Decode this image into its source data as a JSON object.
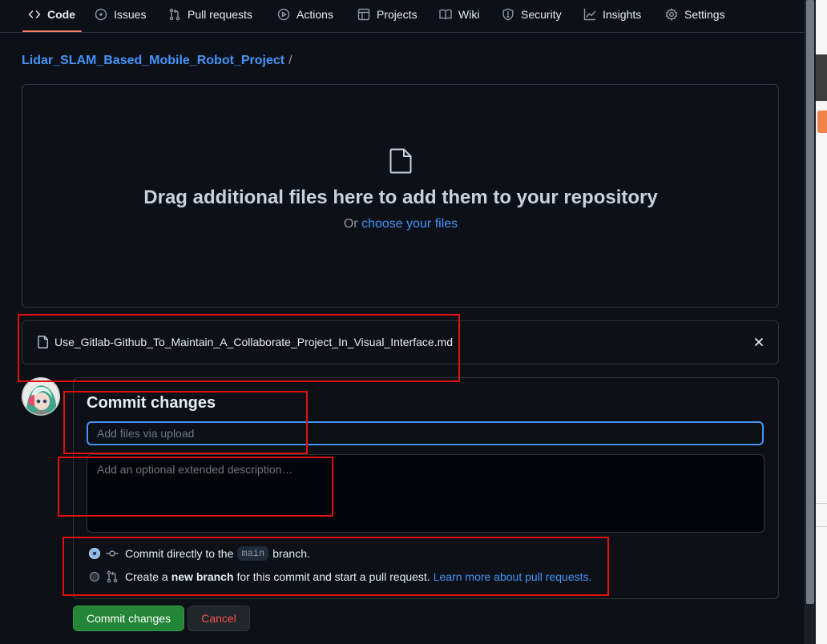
{
  "nav": {
    "tabs": [
      {
        "label": "Code",
        "icon": "code-icon",
        "active": true
      },
      {
        "label": "Issues",
        "icon": "issue-opened-icon",
        "active": false
      },
      {
        "label": "Pull requests",
        "icon": "git-pull-request-icon",
        "active": false
      },
      {
        "label": "Actions",
        "icon": "play-icon",
        "active": false
      },
      {
        "label": "Projects",
        "icon": "table-icon",
        "active": false
      },
      {
        "label": "Wiki",
        "icon": "book-icon",
        "active": false
      },
      {
        "label": "Security",
        "icon": "shield-icon",
        "active": false
      },
      {
        "label": "Insights",
        "icon": "graph-icon",
        "active": false
      },
      {
        "label": "Settings",
        "icon": "gear-icon",
        "active": false
      }
    ],
    "accent_color": "#f78166"
  },
  "breadcrumb": {
    "repo": "Lidar_SLAM_Based_Mobile_Robot_Project",
    "separator": "/"
  },
  "dropzone": {
    "icon": "file-icon",
    "title": "Drag additional files here to add them to your repository",
    "sub_prefix": "Or",
    "sub_link": "choose your files"
  },
  "uploaded_file": {
    "icon": "file-icon",
    "name": "Use_Gitlab-Github_To_Maintain_A_Collaborate_Project_In_Visual_Interface.md",
    "remove_icon": "x-icon"
  },
  "commit": {
    "heading": "Commit changes",
    "summary_value": "",
    "summary_placeholder": "Add files via upload",
    "description_placeholder": "Add an optional extended description…",
    "options": [
      {
        "selected": true,
        "icon": "git-commit-icon",
        "text1": "Commit directly to the",
        "branch": "main",
        "text2": "branch."
      },
      {
        "selected": false,
        "icon": "git-pull-request-icon",
        "text1": "Create a",
        "bold": "new branch",
        "text2": "for this commit and start a pull request.",
        "link": "Learn more about pull requests."
      }
    ],
    "submit_label": "Commit changes",
    "cancel_label": "Cancel"
  },
  "colors": {
    "background": "#0d1117",
    "link": "#4493f8",
    "primary_button": "#238636",
    "danger_text": "#f85149",
    "annotation": "#e01010"
  }
}
